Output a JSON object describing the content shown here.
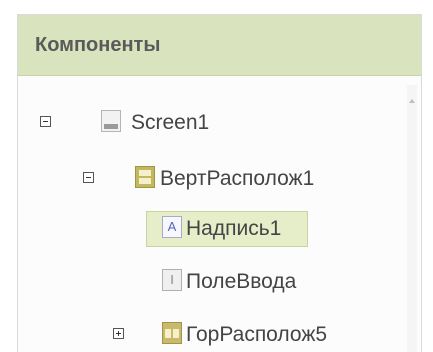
{
  "panel": {
    "title": "Компоненты"
  },
  "tree": [
    {
      "label": "Screen1",
      "icon": "screen-icon",
      "toggle": "minus"
    },
    {
      "label": "ВертРасполож1",
      "icon": "vertical-arrangement-icon",
      "toggle": "minus"
    },
    {
      "label": "Надпись1",
      "icon": "label-icon",
      "selected": true
    },
    {
      "label": "ПолеВвода",
      "icon": "textbox-icon"
    },
    {
      "label": "ГорРасполож5",
      "icon": "horizontal-arrangement-icon",
      "toggle": "plus"
    }
  ],
  "icons": {
    "label_glyph": "A",
    "textbox_glyph": "I"
  },
  "colors": {
    "header_background": "#d9e3bd",
    "selected_background": "#e6edc9"
  }
}
